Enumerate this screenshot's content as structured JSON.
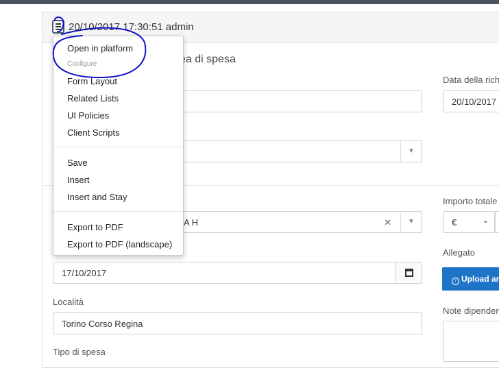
{
  "record": {
    "title": "20/10/2017 17:30:51 admin",
    "section_title_partial": "ea di spesa"
  },
  "menu": {
    "items_group1": [
      "Open in platform"
    ],
    "configure_label": "Configure",
    "configure_items": [
      "Form Layout",
      "Related Lists",
      "UI Policies",
      "Client Scripts"
    ],
    "save_items": [
      "Save",
      "Insert",
      "Insert and Stay"
    ],
    "export_items": [
      "Export to PDF",
      "Export to PDF (landscape)"
    ]
  },
  "form": {
    "data_richiesta_label": "Data della rich",
    "data_richiesta_value": "20/10/2017",
    "importo_label": "Importo totale",
    "currency_value": "€",
    "lookup_value_partial": "A H",
    "date_value": "17/10/2017",
    "allegato_label": "Allegato",
    "upload_label": "Upload an",
    "localita_label": "Località",
    "localita_value": "Torino Corso Regina",
    "note_label": "Note dipender",
    "tipo_label": "Tipo di spesa"
  },
  "colors": {
    "annotation_ink": "#1010c8",
    "primary_button": "#1e74c7",
    "header_bar": "#4a5561"
  },
  "icons": {
    "menu": "hamburger-icon",
    "calendar": "calendar-icon",
    "upload": "upload-icon",
    "dropdown": "chevron-down-icon",
    "clear": "clear-x-icon"
  }
}
